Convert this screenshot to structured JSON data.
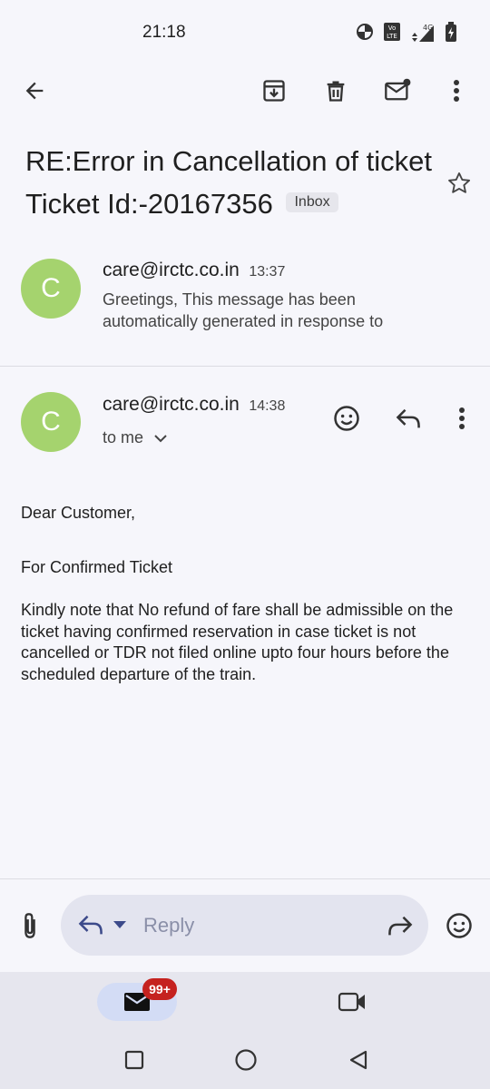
{
  "status_bar": {
    "time": "21:18",
    "icons": [
      "data-saver-icon",
      "volte-icon",
      "signal-4g-icon",
      "battery-charging-icon"
    ]
  },
  "toolbar": {
    "icons": [
      "back-arrow-icon",
      "archive-icon",
      "delete-icon",
      "mark-unread-icon",
      "more-vert-icon"
    ]
  },
  "subject": {
    "text": "RE:Error in Cancellation of ticket Ticket Id:-20167356",
    "label": "Inbox"
  },
  "collapsed_message": {
    "avatar_letter": "C",
    "sender": "care@irctc.co.in",
    "time": "13:37",
    "snippet": "Greetings, This message has been automatically generated in response to"
  },
  "expanded_message": {
    "avatar_letter": "C",
    "sender": "care@irctc.co.in",
    "time": "14:38",
    "recipient": "to me",
    "body": {
      "greeting": "Dear Customer,",
      "heading": "For Confirmed Ticket",
      "paragraph": "Kindly note that No refund of fare shall be admissible on the ticket having confirmed reservation in case ticket is not cancelled or TDR not filed online upto four hours before the scheduled departure of the train."
    }
  },
  "reply_bar": {
    "placeholder": "Reply"
  },
  "bottom_nav": {
    "mail_badge": "99+"
  },
  "colors": {
    "background": "#f6f6fb",
    "avatar": "#a5d36e",
    "badge": "#c5221f",
    "reply_pill": "#e3e4ef"
  }
}
